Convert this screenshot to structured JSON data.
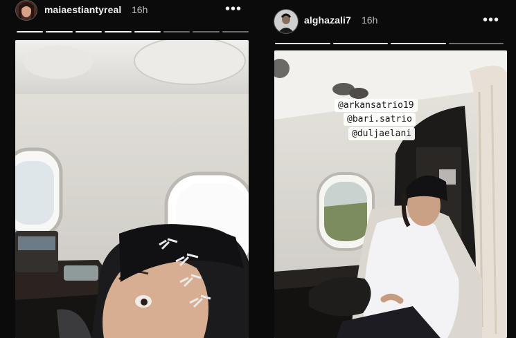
{
  "stories": [
    {
      "username": "maiaestiantyreal",
      "timestamp": "16h",
      "more_icon": "ellipsis-icon",
      "progress": {
        "segments": 8,
        "viewed": 5
      }
    },
    {
      "username": "alghazali7",
      "timestamp": "16h",
      "more_icon": "ellipsis-icon",
      "progress": {
        "segments": 4,
        "viewed": 3
      },
      "mentions": [
        "@arkansatrio19",
        "@bari.satrio",
        "@duljaelani"
      ]
    }
  ],
  "colors": {
    "background": "#0b0b0b",
    "progress_viewed": "#f2f2f2",
    "progress_unviewed": "#6d6d6d",
    "mention_bg": "#ffffff"
  }
}
